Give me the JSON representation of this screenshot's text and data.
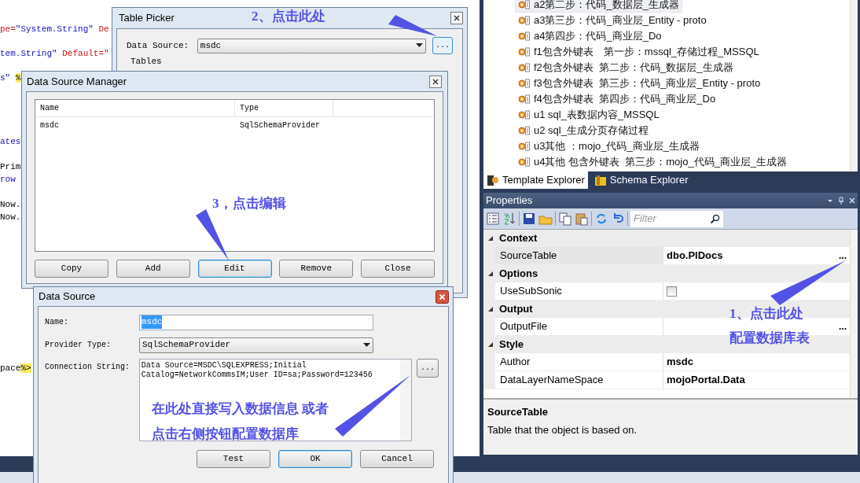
{
  "code_editor": {
    "lines": [
      {
        "segments": [
          {
            "text": "pe=",
            "kind": "attr"
          },
          {
            "text": "\"System.String\"",
            "kind": "string"
          },
          {
            "text": " De",
            "kind": "attr"
          }
        ]
      },
      {
        "segments": [
          {
            "text": "tem.String\"",
            "kind": "string"
          },
          {
            "text": " Default=\"",
            "kind": "attr"
          }
        ]
      },
      {
        "segments": [
          {
            "text": "s\" ",
            "kind": "string"
          },
          {
            "text": "%",
            "kind": "delimiter"
          }
        ]
      },
      {
        "segments": [
          {
            "text": "ates",
            "kind": "string"
          }
        ]
      },
      {
        "segments": [
          {
            "text": "Prim",
            "kind": "plain"
          }
        ]
      },
      {
        "segments": [
          {
            "text": "row",
            "kind": "string"
          }
        ]
      },
      {
        "segments": [
          {
            "text": "Now.",
            "kind": "plain"
          }
        ]
      },
      {
        "segments": [
          {
            "text": "Now.",
            "kind": "plain"
          }
        ]
      },
      {
        "segments": [
          {
            "text": "pace",
            "kind": "plain"
          },
          {
            "text": "%>",
            "kind": "delimiter"
          }
        ]
      }
    ]
  },
  "template_explorer": {
    "items": [
      {
        "label": "a2第二步：代码_数据层_生成器",
        "selected": true
      },
      {
        "label": "a3第三步：代码_商业层_Entity - proto",
        "selected": false
      },
      {
        "label": "a4第四步：代码_商业层_Do",
        "selected": false
      },
      {
        "label": "f1包含外键表　第一步：mssql_存储过程_MSSQL",
        "selected": false
      },
      {
        "label": "f2包含外键表  第二步：代码_数据层_生成器",
        "selected": false
      },
      {
        "label": "f3包含外键表  第三步：代码_商业层_Entity - proto",
        "selected": false
      },
      {
        "label": "f4包含外键表  第四步：代码_商业层_Do",
        "selected": false
      },
      {
        "label": "u1 sql_表数据内容_MSSQL",
        "selected": false
      },
      {
        "label": "u2 sql_生成分页存储过程",
        "selected": false
      },
      {
        "label": "u3其他 ：mojo_代码_商业层_生成器",
        "selected": false
      },
      {
        "label": "u4其他 包含外键表  第三步：mojo_代码_商业层_生成器",
        "selected": false
      }
    ],
    "tabs": [
      {
        "label": "Template Explorer",
        "selected": true
      },
      {
        "label": "Schema Explorer",
        "selected": false
      }
    ]
  },
  "properties": {
    "title": "Properties",
    "filter_placeholder": "Filter",
    "categories": [
      {
        "name": "Context",
        "expanded": true,
        "rows": [
          {
            "name": "SourceTable",
            "kind": "text",
            "value": "dbo.PlDocs",
            "browse": "...",
            "selected": true
          }
        ]
      },
      {
        "name": "Options",
        "expanded": true,
        "rows": [
          {
            "name": "UseSubSonic",
            "kind": "checkbox",
            "checked": false,
            "selected": false
          }
        ]
      },
      {
        "name": "Output",
        "expanded": true,
        "rows": [
          {
            "name": "OutputFile",
            "kind": "text",
            "browse": "...",
            "selected": false
          }
        ]
      },
      {
        "name": "Style",
        "expanded": true,
        "rows": [
          {
            "name": "Author",
            "kind": "text",
            "value": "msdc",
            "selected": false
          },
          {
            "name": "DataLayerNameSpace",
            "kind": "text",
            "value": "mojoPortal.Data",
            "selected": false
          }
        ]
      }
    ],
    "description": {
      "title": "SourceTable",
      "text": "Table that the object is based on."
    }
  },
  "table_picker": {
    "title": "Table Picker",
    "data_source_label": "Data Source:",
    "data_source_value": "msdc",
    "browse": "...",
    "tables_label": "Tables"
  },
  "data_source_manager": {
    "title": "Data Source Manager",
    "columns": [
      "Name",
      "Type"
    ],
    "rows": [
      {
        "cells": [
          "msdc",
          "SqlSchemaProvider"
        ]
      }
    ],
    "buttons": [
      {
        "label": "Copy",
        "focused": false
      },
      {
        "label": "Add",
        "focused": false
      },
      {
        "label": "Edit",
        "focused": true
      },
      {
        "label": "Remove",
        "focused": false
      },
      {
        "label": "Close",
        "focused": false
      }
    ]
  },
  "data_source_dialog": {
    "title": "Data Source",
    "name_label": "Name:",
    "name_value": "msdc",
    "name_selected": true,
    "provider_label": "Provider Type:",
    "provider_value": "SqlSchemaProvider",
    "connection_label": "Connection String:",
    "connection_value": "Data Source=MSDC\\SQLEXPRESS;Initial Catalog=NetworkCommsIM;User ID=sa;Password=123456",
    "browse": "...",
    "buttons": [
      {
        "label": "Test",
        "focused": false
      },
      {
        "label": "OK",
        "focused": true
      },
      {
        "label": "Cancel",
        "focused": false
      }
    ]
  },
  "annotations": [
    {
      "text": "2、点击此处"
    },
    {
      "text": "3，点击编辑"
    },
    {
      "text": "1、点击此处"
    },
    {
      "text": "配置数据库表"
    },
    {
      "text": "在此处直接写入数据信息 或者"
    },
    {
      "text": "点击右侧按钮配置数据库"
    }
  ]
}
